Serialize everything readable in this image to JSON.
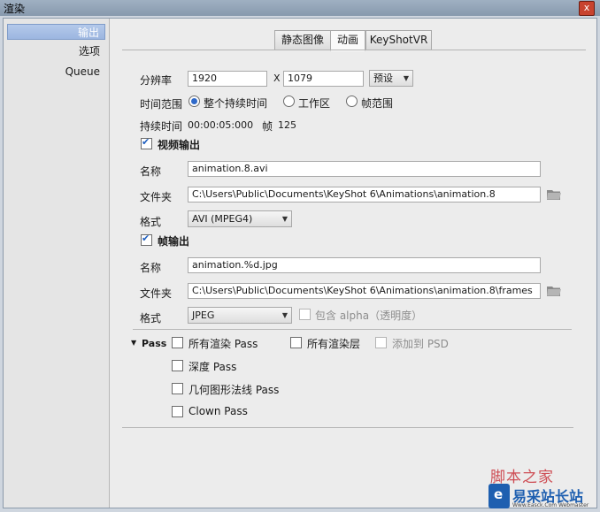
{
  "window": {
    "title": "渲染",
    "close_symbol": "x"
  },
  "sidebar": {
    "items": [
      {
        "label": "输出"
      },
      {
        "label": "选项"
      },
      {
        "label": "Queue"
      }
    ]
  },
  "tabs": [
    {
      "label": "静态图像"
    },
    {
      "label": "动画"
    },
    {
      "label": "KeyShotVR"
    }
  ],
  "resolution": {
    "label": "分辨率",
    "width": "1920",
    "x": "X",
    "height": "1079",
    "preset": "预设"
  },
  "time_range": {
    "label": "时间范围",
    "options": [
      {
        "label": "整个持续时间",
        "checked": true
      },
      {
        "label": "工作区",
        "checked": false
      },
      {
        "label": "帧范围",
        "checked": false
      }
    ]
  },
  "duration": {
    "label": "持续时间",
    "value": "00:00:05:000",
    "frames_label": "帧",
    "frames_value": "125"
  },
  "video_output": {
    "label": "视频输出",
    "checked": true,
    "name_label": "名称",
    "name_value": "animation.8.avi",
    "folder_label": "文件夹",
    "folder_value": "C:\\Users\\Public\\Documents\\KeyShot 6\\Animations\\animation.8",
    "format_label": "格式",
    "format_value": "AVI (MPEG4)"
  },
  "frame_output": {
    "label": "帧输出",
    "checked": true,
    "name_label": "名称",
    "name_value": "animation.%d.jpg",
    "folder_label": "文件夹",
    "folder_value": "C:\\Users\\Public\\Documents\\KeyShot 6\\Animations\\animation.8\\frames",
    "format_label": "格式",
    "format_value": "JPEG",
    "alpha_label": "包含 alpha（透明度）"
  },
  "pass": {
    "label": "Pass",
    "items": [
      {
        "label": "所有渲染 Pass"
      },
      {
        "label": "所有渲染层"
      },
      {
        "label": "添加到 PSD"
      },
      {
        "label": "深度 Pass"
      },
      {
        "label": "几何图形法线 Pass"
      },
      {
        "label": "Clown Pass"
      }
    ]
  },
  "watermark": {
    "text1": "脚本之家",
    "text2": "易采站长站",
    "text3": "Www.Easck.Com Webmaster"
  }
}
